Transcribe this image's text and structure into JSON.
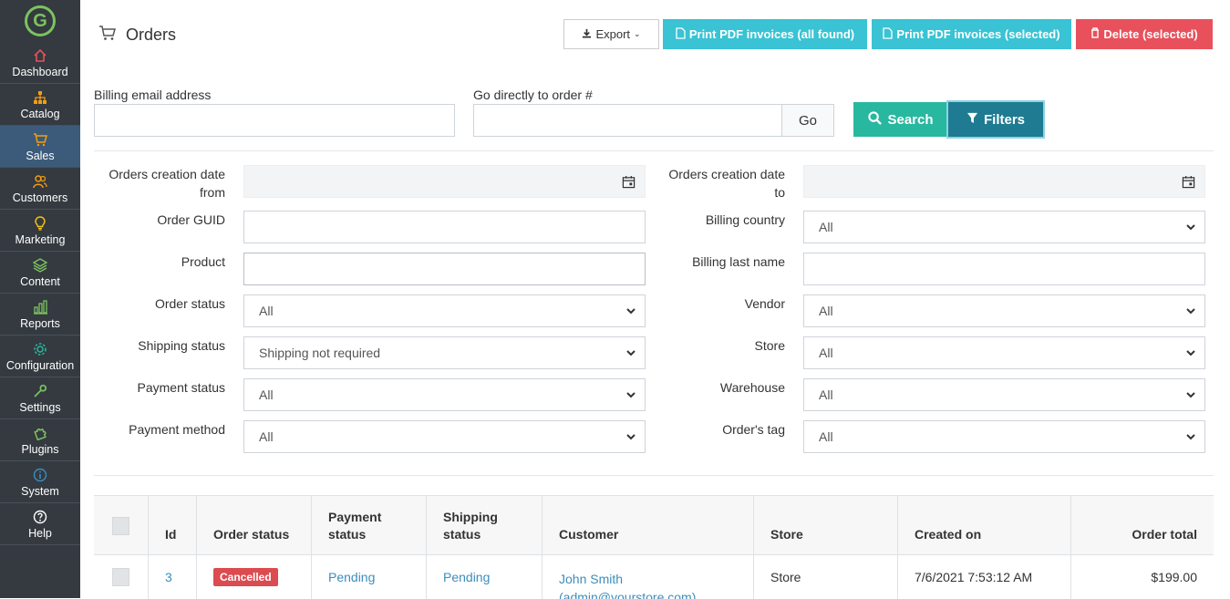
{
  "sidebar": {
    "logo_letter": "G",
    "items": [
      {
        "label": "Dashboard",
        "icon": "home-icon",
        "color": "#e8505b"
      },
      {
        "label": "Catalog",
        "icon": "sitemap-icon",
        "color": "#f39c12"
      },
      {
        "label": "Sales",
        "icon": "cart-icon",
        "color": "#f39c12"
      },
      {
        "label": "Customers",
        "icon": "users-icon",
        "color": "#f39c12"
      },
      {
        "label": "Marketing",
        "icon": "lightbulb-icon",
        "color": "#f1c40f"
      },
      {
        "label": "Content",
        "icon": "layers-icon",
        "color": "#7cc35f"
      },
      {
        "label": "Reports",
        "icon": "bar-chart-icon",
        "color": "#7cc35f"
      },
      {
        "label": "Configuration",
        "icon": "gears-icon",
        "color": "#28b8a0"
      },
      {
        "label": "Settings",
        "icon": "wrench-icon",
        "color": "#7cc35f"
      },
      {
        "label": "Plugins",
        "icon": "puzzle-icon",
        "color": "#7cc35f"
      },
      {
        "label": "System",
        "icon": "info-icon",
        "color": "#3c8dbc"
      },
      {
        "label": "Help",
        "icon": "question-icon",
        "color": "#ffffff"
      }
    ]
  },
  "header": {
    "title": "Orders",
    "export_label": "Export",
    "print_all_label": "Print PDF invoices (all found)",
    "print_selected_label": "Print PDF invoices (selected)",
    "delete_selected_label": "Delete (selected)"
  },
  "search": {
    "billing_email_label": "Billing email address",
    "billing_email_value": "",
    "goto_order_label": "Go directly to order #",
    "goto_order_value": "",
    "go_label": "Go",
    "search_label": "Search",
    "filters_label": "Filters"
  },
  "filters": {
    "left": [
      {
        "label_line1": "Orders creation date",
        "label_line2": "from",
        "type": "date",
        "value": ""
      },
      {
        "label_line1": "Order GUID",
        "label_line2": "",
        "type": "text",
        "value": ""
      },
      {
        "label_line1": "Product",
        "label_line2": "",
        "type": "text",
        "value": ""
      },
      {
        "label_line1": "Order status",
        "label_line2": "",
        "type": "select",
        "value": "All"
      },
      {
        "label_line1": "Shipping status",
        "label_line2": "",
        "type": "select",
        "value": "Shipping not required"
      },
      {
        "label_line1": "Payment status",
        "label_line2": "",
        "type": "select",
        "value": "All"
      },
      {
        "label_line1": "Payment method",
        "label_line2": "",
        "type": "select",
        "value": "All"
      }
    ],
    "right": [
      {
        "label_line1": "Orders creation date",
        "label_line2": "to",
        "type": "date",
        "value": ""
      },
      {
        "label_line1": "Billing country",
        "label_line2": "",
        "type": "select",
        "value": "All"
      },
      {
        "label_line1": "Billing last name",
        "label_line2": "",
        "type": "text",
        "value": ""
      },
      {
        "label_line1": "Vendor",
        "label_line2": "",
        "type": "select",
        "value": "All"
      },
      {
        "label_line1": "Store",
        "label_line2": "",
        "type": "select",
        "value": "All"
      },
      {
        "label_line1": "Warehouse",
        "label_line2": "",
        "type": "select",
        "value": "All"
      },
      {
        "label_line1": "Order's tag",
        "label_line2": "",
        "type": "select",
        "value": "All"
      }
    ]
  },
  "table": {
    "columns": [
      "",
      "Id",
      "Order status",
      "Payment status",
      "Shipping status",
      "Customer",
      "Store",
      "Created on",
      "Order total"
    ],
    "column_lines": [
      [
        "",
        ""
      ],
      [
        "",
        "Id"
      ],
      [
        "",
        "Order status"
      ],
      [
        "Payment",
        "status"
      ],
      [
        "Shipping",
        "status"
      ],
      [
        "",
        "Customer"
      ],
      [
        "",
        "Store"
      ],
      [
        "",
        "Created on"
      ],
      [
        "",
        "Order total"
      ]
    ],
    "rows": [
      {
        "id": "3",
        "order_status": "Cancelled",
        "payment_status": "Pending",
        "shipping_status": "Pending",
        "customer_name": "John Smith",
        "customer_email": "(admin@yourstore.com)",
        "store": "Store",
        "created_on": "7/6/2021 7:53:12 AM",
        "order_total": "$199.00"
      }
    ]
  },
  "colors": {
    "sidebar_bg": "#343a40",
    "active_item_bg": "#3c5b7a",
    "info_button": "#39c3d4",
    "danger_button": "#e8505b",
    "search_button": "#28b8a0",
    "filters_button": "#1e7b91"
  }
}
